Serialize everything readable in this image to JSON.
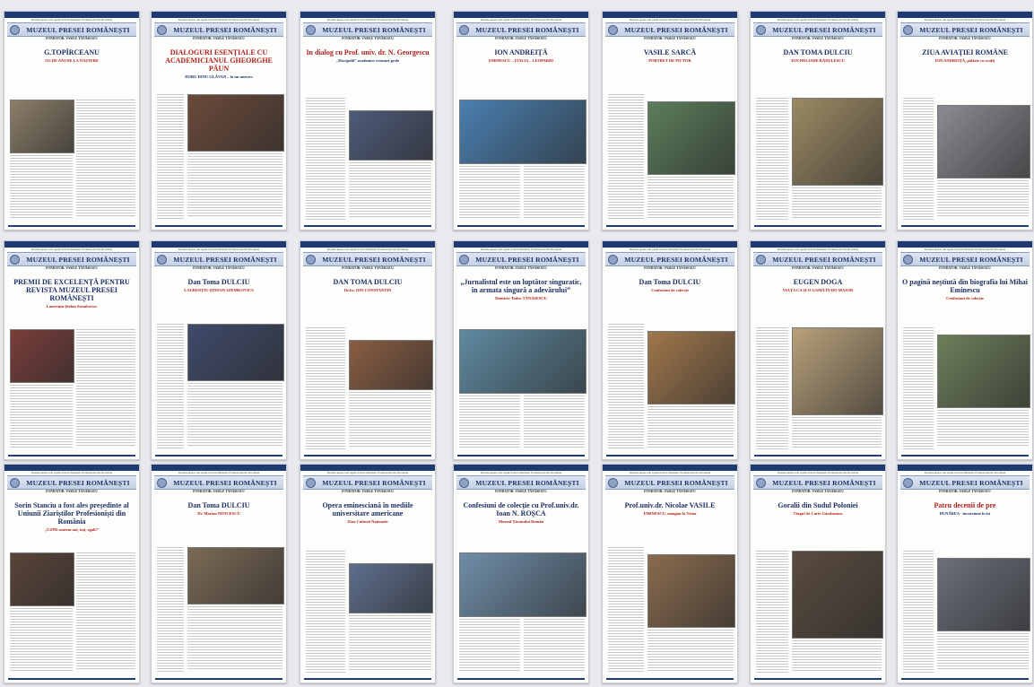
{
  "masthead": "MUZEUL PRESEI ROMÂNEȘTI",
  "header_subtitle": "Revista apare sub egida Uniunii Ziariștilor Profesioniști din România",
  "editor_line": "FONDATOR: VASILE TĂNĂSESCU",
  "colors": {
    "navy": "#1f3a73",
    "masthead_text": "#1b3266",
    "headline_red": "#b0201c",
    "banner": "#c3d0e6"
  },
  "rows": [
    [
      {
        "headline": "G.TOPÎRCEANU",
        "deck": "133 DE ANI DE LA NAȘTERE",
        "headline_color": "blue",
        "photo_color": "#8d7f6a"
      },
      {
        "headline": "DIALOGURI ESENȚIALE CU ACADEMICIANUL GHEORGHE PĂUN",
        "deck": "DORU DINU GLĂVAN – la un univers",
        "headline_color": "red",
        "photo_color": "#6b4a3a"
      },
      {
        "headline": "In dialog cu Prof. univ. dr. N. Georgescu",
        "deck": "„Discipolii” academici vremuri grele",
        "headline_color": "red",
        "photo_color": "#4d5b7a"
      },
      {
        "headline": "ION ANDREIȚĂ",
        "deck": "EMINESCU – ITALIA – LEOPARDI",
        "headline_color": "blue",
        "photo_color": "#4a7fb0"
      },
      {
        "headline": "VASILE SARCĂ",
        "deck": "PORTRET DE PICTOR",
        "headline_color": "blue",
        "photo_color": "#5b7d5a"
      },
      {
        "headline": "DAN TOMA DULCIU",
        "deck": "ION HELIADE RĂDULESCU",
        "headline_color": "blue",
        "photo_color": "#9c8a63"
      },
      {
        "headline": "ZIUA AVIAȚIEI ROMÂNE",
        "deck": "ION ANDREIȚĂ, pălărie cu scufiț",
        "headline_color": "blue",
        "photo_color": "#8a8c92"
      }
    ],
    [
      {
        "headline": "PREMII DE EXCELENȚĂ PENTRU REVISTA MUZEUL PRESEI ROMÂNEȘTI",
        "deck": "Laurențiu-Ștefan Szemkovics",
        "headline_color": "blue",
        "photo_color": "#7a3e3a"
      },
      {
        "headline": "Dan Toma DULCIU",
        "deck": "LAURENȚIU-ȘTEFAN SZEMKOVICS",
        "headline_color": "blue",
        "photo_color": "#3f4a6b"
      },
      {
        "headline": "DAN TOMA DULCIU",
        "deck": "Dr.Ist. ION CONSTANTIN",
        "headline_color": "blue",
        "photo_color": "#8a5e42"
      },
      {
        "headline": "„Jurnalistul este un luptător singuratic, în armata singură a adevărului”",
        "deck": "Dimitrie-Tudor TĂNĂSESCU",
        "headline_color": "blue",
        "photo_color": "#5f8aa0"
      },
      {
        "headline": "Dan Toma DULCIU",
        "deck": "Confesiuni de colecție",
        "headline_color": "blue",
        "photo_color": "#a0774b"
      },
      {
        "headline": "EUGEN DOGA",
        "deck": "VIAȚA CA ȘI O GAMĂ ÎN DO MAJOR",
        "headline_color": "blue",
        "photo_color": "#b9a17a"
      },
      {
        "headline": "O pagină neștiută din biografia lui Mihai Eminescu",
        "deck": "Confesiuni de colecție",
        "headline_color": "blue",
        "photo_color": "#6d7e5a"
      }
    ],
    [
      {
        "headline": "Sorin Stanciu a fost ales președinte al Uniunii Ziariștilor Profesioniști din România",
        "deck": "„UZPR suntem noi, toți, egali!”",
        "headline_color": "blue",
        "photo_color": "#5a4438"
      },
      {
        "headline": "Dan Toma DULCIU",
        "deck": "Dr. Marian NENCESCU",
        "headline_color": "blue",
        "photo_color": "#7b6a55"
      },
      {
        "headline": "Opera eminesciană în mediile universitare americane",
        "deck": "Ziua Culturii Naționale",
        "headline_color": "blue",
        "photo_color": "#5e6f8e"
      },
      {
        "headline": "Confesiuni de colecție cu Prof.univ.dr. Ioan N. ROȘCA",
        "deck": "Muzeul Țăranului Român",
        "headline_color": "blue",
        "photo_color": "#6f8da8"
      },
      {
        "headline": "Prof.univ.dr. Nicolae VASILE",
        "deck": "EMINESCU, omagiat la Viena",
        "headline_color": "blue",
        "photo_color": "#8a6b4e"
      },
      {
        "headline": "Goralii din Sudul Poloniei",
        "deck": "Târgul de Carte Gaudeamus",
        "headline_color": "blue",
        "photo_color": "#5a4b3e"
      },
      {
        "headline": "Patru decenii de pre",
        "deck": "DUNĂREA - incursiune în ist",
        "headline_color": "red",
        "photo_color": "#6a6f7a"
      }
    ]
  ]
}
